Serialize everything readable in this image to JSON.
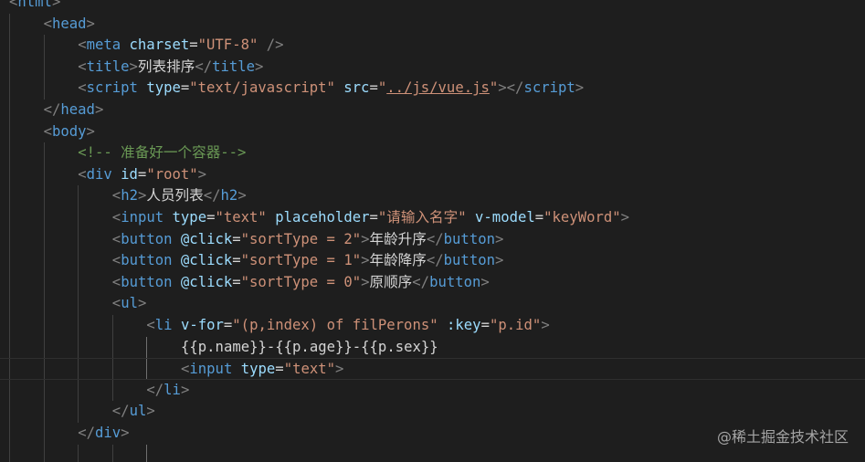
{
  "lines": [
    {
      "indent": 0,
      "tokens": [
        {
          "t": "<",
          "c": "punct"
        },
        {
          "t": "html",
          "c": "tag"
        },
        {
          "t": ">",
          "c": "punct"
        }
      ]
    },
    {
      "indent": 1,
      "tokens": [
        {
          "t": "<",
          "c": "punct"
        },
        {
          "t": "head",
          "c": "tag"
        },
        {
          "t": ">",
          "c": "punct"
        }
      ]
    },
    {
      "indent": 2,
      "tokens": [
        {
          "t": "<",
          "c": "punct"
        },
        {
          "t": "meta",
          "c": "tag"
        },
        {
          "t": " ",
          "c": "txt"
        },
        {
          "t": "charset",
          "c": "attr"
        },
        {
          "t": "=",
          "c": "txt"
        },
        {
          "t": "\"UTF-8\"",
          "c": "str"
        },
        {
          "t": " ",
          "c": "txt"
        },
        {
          "t": "/>",
          "c": "punct"
        }
      ]
    },
    {
      "indent": 2,
      "tokens": [
        {
          "t": "<",
          "c": "punct"
        },
        {
          "t": "title",
          "c": "tag"
        },
        {
          "t": ">",
          "c": "punct"
        },
        {
          "t": "列表排序",
          "c": "txt"
        },
        {
          "t": "</",
          "c": "punct"
        },
        {
          "t": "title",
          "c": "tag"
        },
        {
          "t": ">",
          "c": "punct"
        }
      ]
    },
    {
      "indent": 2,
      "tokens": [
        {
          "t": "<",
          "c": "punct"
        },
        {
          "t": "script",
          "c": "tag"
        },
        {
          "t": " ",
          "c": "txt"
        },
        {
          "t": "type",
          "c": "attr"
        },
        {
          "t": "=",
          "c": "txt"
        },
        {
          "t": "\"text/javascript\"",
          "c": "str"
        },
        {
          "t": " ",
          "c": "txt"
        },
        {
          "t": "src",
          "c": "attr"
        },
        {
          "t": "=",
          "c": "txt"
        },
        {
          "t": "\"",
          "c": "str"
        },
        {
          "t": "../js/vue.js",
          "c": "str link"
        },
        {
          "t": "\"",
          "c": "str"
        },
        {
          "t": ">",
          "c": "punct"
        },
        {
          "t": "</",
          "c": "punct"
        },
        {
          "t": "script",
          "c": "tag"
        },
        {
          "t": ">",
          "c": "punct"
        }
      ]
    },
    {
      "indent": 1,
      "tokens": [
        {
          "t": "</",
          "c": "punct"
        },
        {
          "t": "head",
          "c": "tag"
        },
        {
          "t": ">",
          "c": "punct"
        }
      ]
    },
    {
      "indent": 1,
      "tokens": [
        {
          "t": "<",
          "c": "punct"
        },
        {
          "t": "body",
          "c": "tag"
        },
        {
          "t": ">",
          "c": "punct"
        }
      ]
    },
    {
      "indent": 2,
      "tokens": [
        {
          "t": "<!-- 准备好一个容器-->",
          "c": "cmt"
        }
      ]
    },
    {
      "indent": 2,
      "tokens": [
        {
          "t": "<",
          "c": "punct"
        },
        {
          "t": "div",
          "c": "tag"
        },
        {
          "t": " ",
          "c": "txt"
        },
        {
          "t": "id",
          "c": "attr"
        },
        {
          "t": "=",
          "c": "txt"
        },
        {
          "t": "\"root\"",
          "c": "str"
        },
        {
          "t": ">",
          "c": "punct"
        }
      ]
    },
    {
      "indent": 3,
      "tokens": [
        {
          "t": "<",
          "c": "punct"
        },
        {
          "t": "h2",
          "c": "tag"
        },
        {
          "t": ">",
          "c": "punct"
        },
        {
          "t": "人员列表",
          "c": "txt"
        },
        {
          "t": "</",
          "c": "punct"
        },
        {
          "t": "h2",
          "c": "tag"
        },
        {
          "t": ">",
          "c": "punct"
        }
      ]
    },
    {
      "indent": 3,
      "tokens": [
        {
          "t": "<",
          "c": "punct"
        },
        {
          "t": "input",
          "c": "tag"
        },
        {
          "t": " ",
          "c": "txt"
        },
        {
          "t": "type",
          "c": "attr"
        },
        {
          "t": "=",
          "c": "txt"
        },
        {
          "t": "\"text\"",
          "c": "str"
        },
        {
          "t": " ",
          "c": "txt"
        },
        {
          "t": "placeholder",
          "c": "attr"
        },
        {
          "t": "=",
          "c": "txt"
        },
        {
          "t": "\"请输入名字\"",
          "c": "str"
        },
        {
          "t": " ",
          "c": "txt"
        },
        {
          "t": "v-model",
          "c": "attr"
        },
        {
          "t": "=",
          "c": "txt"
        },
        {
          "t": "\"keyWord\"",
          "c": "str"
        },
        {
          "t": ">",
          "c": "punct"
        }
      ]
    },
    {
      "indent": 3,
      "tokens": [
        {
          "t": "<",
          "c": "punct"
        },
        {
          "t": "button",
          "c": "tag"
        },
        {
          "t": " ",
          "c": "txt"
        },
        {
          "t": "@click",
          "c": "attr"
        },
        {
          "t": "=",
          "c": "txt"
        },
        {
          "t": "\"sortType = 2\"",
          "c": "str"
        },
        {
          "t": ">",
          "c": "punct"
        },
        {
          "t": "年龄升序",
          "c": "txt"
        },
        {
          "t": "</",
          "c": "punct"
        },
        {
          "t": "button",
          "c": "tag"
        },
        {
          "t": ">",
          "c": "punct"
        }
      ]
    },
    {
      "indent": 3,
      "tokens": [
        {
          "t": "<",
          "c": "punct"
        },
        {
          "t": "button",
          "c": "tag"
        },
        {
          "t": " ",
          "c": "txt"
        },
        {
          "t": "@click",
          "c": "attr"
        },
        {
          "t": "=",
          "c": "txt"
        },
        {
          "t": "\"sortType = 1\"",
          "c": "str"
        },
        {
          "t": ">",
          "c": "punct"
        },
        {
          "t": "年龄降序",
          "c": "txt"
        },
        {
          "t": "</",
          "c": "punct"
        },
        {
          "t": "button",
          "c": "tag"
        },
        {
          "t": ">",
          "c": "punct"
        }
      ]
    },
    {
      "indent": 3,
      "tokens": [
        {
          "t": "<",
          "c": "punct"
        },
        {
          "t": "button",
          "c": "tag"
        },
        {
          "t": " ",
          "c": "txt"
        },
        {
          "t": "@click",
          "c": "attr"
        },
        {
          "t": "=",
          "c": "txt"
        },
        {
          "t": "\"sortType = 0\"",
          "c": "str"
        },
        {
          "t": ">",
          "c": "punct"
        },
        {
          "t": "原顺序",
          "c": "txt"
        },
        {
          "t": "</",
          "c": "punct"
        },
        {
          "t": "button",
          "c": "tag"
        },
        {
          "t": ">",
          "c": "punct"
        }
      ]
    },
    {
      "indent": 3,
      "tokens": [
        {
          "t": "<",
          "c": "punct"
        },
        {
          "t": "ul",
          "c": "tag"
        },
        {
          "t": ">",
          "c": "punct"
        }
      ]
    },
    {
      "indent": 4,
      "tokens": [
        {
          "t": "<",
          "c": "punct"
        },
        {
          "t": "li",
          "c": "tag"
        },
        {
          "t": " ",
          "c": "txt"
        },
        {
          "t": "v-for",
          "c": "attr"
        },
        {
          "t": "=",
          "c": "txt"
        },
        {
          "t": "\"(p,index) of filPerons\"",
          "c": "str"
        },
        {
          "t": " ",
          "c": "txt"
        },
        {
          "t": ":key",
          "c": "attr"
        },
        {
          "t": "=",
          "c": "txt"
        },
        {
          "t": "\"p.id\"",
          "c": "str"
        },
        {
          "t": ">",
          "c": "punct"
        }
      ]
    },
    {
      "indent": 5,
      "tokens": [
        {
          "t": "{{p.name}}-{{p.age}}-{{p.sex}}",
          "c": "txt"
        }
      ]
    },
    {
      "indent": 5,
      "active": true,
      "tokens": [
        {
          "t": "<",
          "c": "punct"
        },
        {
          "t": "input",
          "c": "tag"
        },
        {
          "t": " ",
          "c": "txt"
        },
        {
          "t": "type",
          "c": "attr"
        },
        {
          "t": "=",
          "c": "txt"
        },
        {
          "t": "\"text\"",
          "c": "str"
        },
        {
          "t": ">",
          "c": "punct"
        }
      ]
    },
    {
      "indent": 4,
      "tokens": [
        {
          "t": "</",
          "c": "punct"
        },
        {
          "t": "li",
          "c": "tag"
        },
        {
          "t": ">",
          "c": "punct"
        }
      ]
    },
    {
      "indent": 3,
      "tokens": [
        {
          "t": "</",
          "c": "punct"
        },
        {
          "t": "ul",
          "c": "tag"
        },
        {
          "t": ">",
          "c": "punct"
        }
      ]
    },
    {
      "indent": 2,
      "tokens": [
        {
          "t": "</",
          "c": "punct"
        },
        {
          "t": "div",
          "c": "tag"
        },
        {
          "t": ">",
          "c": "punct"
        }
      ]
    },
    {
      "indent": 2,
      "tokens": []
    }
  ],
  "watermark": "@稀土掘金技术社区",
  "colors": {
    "background": "#1e1e1e",
    "tag": "#569cd6",
    "attribute": "#9cdcfe",
    "string": "#ce9178",
    "text": "#d4d4d4",
    "punctuation": "#808080",
    "comment": "#6a9955"
  }
}
